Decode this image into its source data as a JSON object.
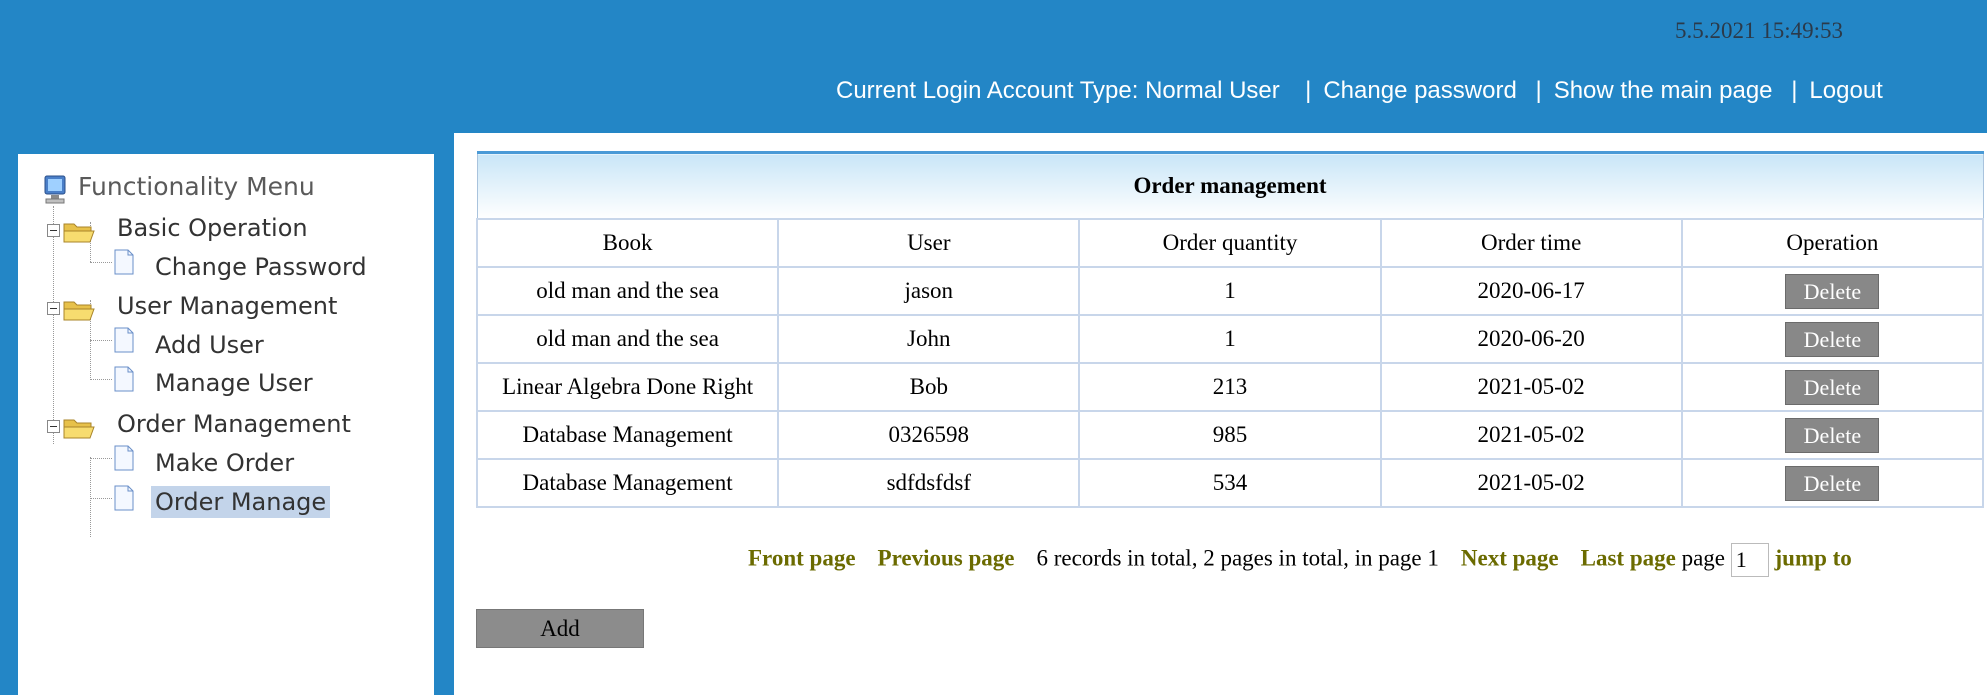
{
  "header": {
    "datetime": "5.5.2021 15:49:53",
    "account_type": "Current Login Account Type: Normal User",
    "links": {
      "change_password": "Change password",
      "main_page": "Show the main page",
      "logout": "Logout"
    }
  },
  "sidebar": {
    "title": "Functionality Menu",
    "groups": [
      {
        "label": "Basic Operation",
        "items": [
          "Change Password"
        ]
      },
      {
        "label": "User Management",
        "items": [
          "Add User",
          "Manage User"
        ]
      },
      {
        "label": "Order Management",
        "items": [
          "Make Order",
          "Order Manage"
        ]
      }
    ],
    "selected": "Order Manage"
  },
  "main": {
    "table_title": "Order management",
    "columns": [
      "Book",
      "User",
      "Order quantity",
      "Order time",
      "Operation"
    ],
    "rows": [
      {
        "book": "old man and the sea",
        "user": "jason",
        "quantity": "1",
        "time": "2020-06-17",
        "action": "Delete"
      },
      {
        "book": "old man and the sea",
        "user": "John",
        "quantity": "1",
        "time": "2020-06-20",
        "action": "Delete"
      },
      {
        "book": "Linear Algebra Done Right",
        "user": "Bob",
        "quantity": "213",
        "time": "2021-05-02",
        "action": "Delete"
      },
      {
        "book": "Database Management",
        "user": "0326598",
        "quantity": "985",
        "time": "2021-05-02",
        "action": "Delete"
      },
      {
        "book": "Database Management",
        "user": "sdfdsfdsf",
        "quantity": "534",
        "time": "2021-05-02",
        "action": "Delete"
      }
    ],
    "pager": {
      "front": "Front page",
      "previous": "Previous page",
      "summary": "6 records in total, 2 pages in total, in page 1",
      "next": "Next page",
      "last": "Last page",
      "page_label": "page",
      "page_value": "1",
      "jump": "jump to"
    },
    "add_label": "Add"
  },
  "colors": {
    "header_bg": "#2386c6",
    "pager_link": "#6b6b00",
    "button_gray": "#888888",
    "selected_bg": "#c3d4ea"
  }
}
